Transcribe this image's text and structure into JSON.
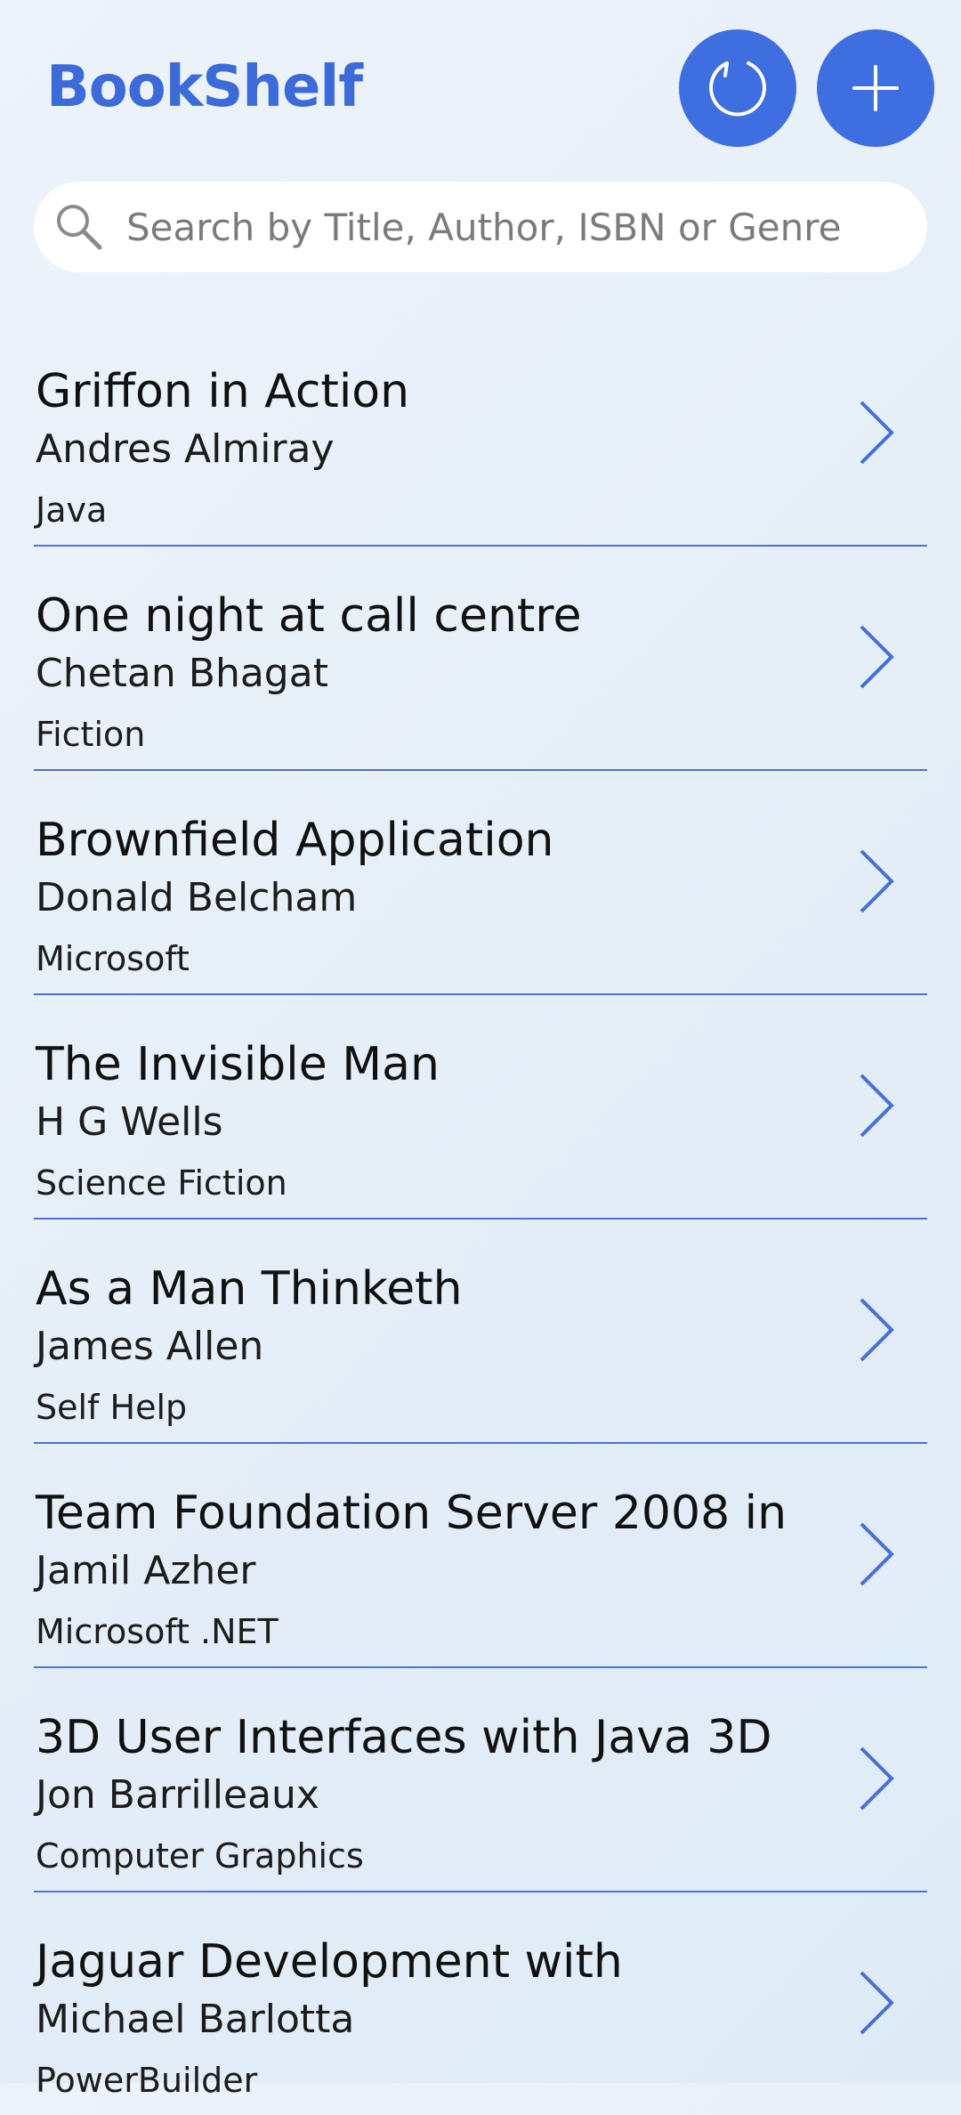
{
  "header": {
    "title": "BookShelf",
    "refresh_icon": "refresh-icon",
    "add_icon": "plus-icon"
  },
  "search": {
    "placeholder": "Search by Title, Author, ISBN or Genre",
    "value": "",
    "icon": "search-icon"
  },
  "colors": {
    "accent": "#3f6ee0",
    "title": "#3c6ad8",
    "divider": "#4a74d3",
    "background": "#e6eef8"
  },
  "books": [
    {
      "title": "Griffon in Action",
      "author": "Andres Almiray",
      "genre": "Java"
    },
    {
      "title": "One night at call centre",
      "author": "Chetan Bhagat",
      "genre": "Fiction"
    },
    {
      "title": "Brownfield Application",
      "author": "Donald Belcham",
      "genre": "Microsoft"
    },
    {
      "title": "The Invisible Man",
      "author": "H G Wells",
      "genre": "Science Fiction"
    },
    {
      "title": "As a Man Thinketh",
      "author": "James Allen",
      "genre": "Self Help"
    },
    {
      "title": "Team Foundation Server 2008 in",
      "author": "Jamil Azher",
      "genre": "Microsoft .NET"
    },
    {
      "title": "3D User Interfaces with Java 3D",
      "author": "Jon Barrilleaux",
      "genre": "Computer Graphics"
    },
    {
      "title": "Jaguar Development with",
      "author": "Michael Barlotta",
      "genre": "PowerBuilder"
    }
  ]
}
